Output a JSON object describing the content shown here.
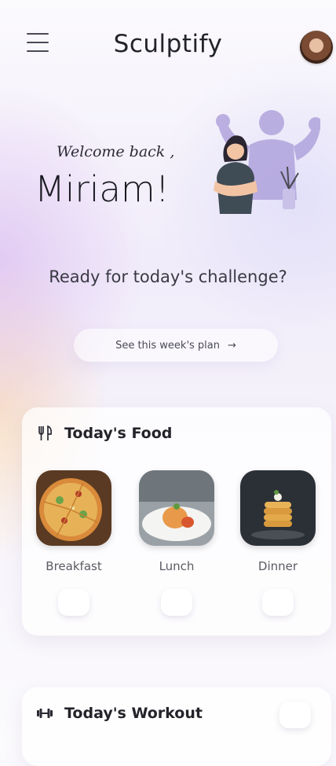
{
  "header": {
    "title": "Sculptify",
    "menu_icon": "hamburger-menu-icon",
    "avatar_icon": "user-avatar"
  },
  "welcome": {
    "greeting": "Welcome back ,",
    "name": "Miriam!"
  },
  "tagline": "Ready for today's challenge?",
  "plan_button": {
    "label": "See this week's plan",
    "arrow": "→"
  },
  "food_card": {
    "title": "Today's Food",
    "icon": "utensils-icon",
    "meals": [
      {
        "label": "Breakfast"
      },
      {
        "label": "Lunch"
      },
      {
        "label": "Dinner"
      }
    ]
  },
  "workout_card": {
    "title": "Today's Workout",
    "icon": "dumbbell-icon"
  },
  "colors": {
    "accent": "#d4b0ee",
    "text": "#23232a"
  }
}
